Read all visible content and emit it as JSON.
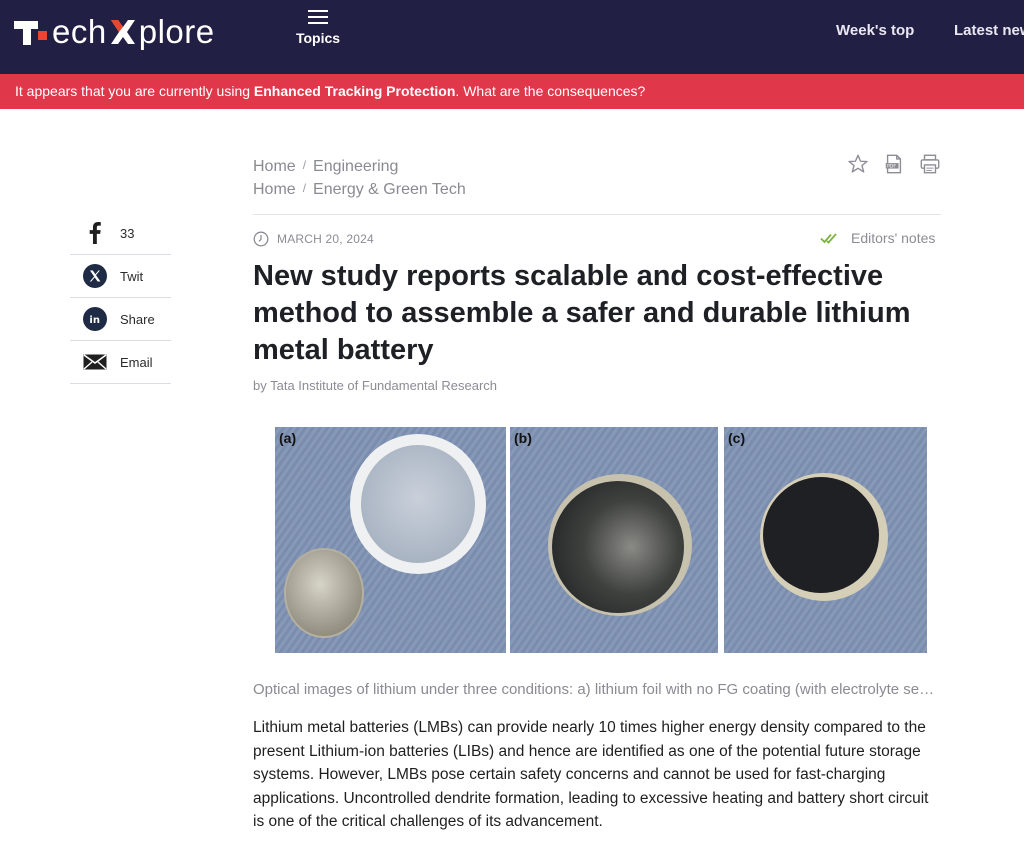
{
  "header": {
    "logo_left": "ech",
    "logo_right": "plore",
    "topics_label": "Topics",
    "nav": [
      "Week's top",
      "Latest news"
    ]
  },
  "alert": {
    "prefix": "It appears that you are currently using ",
    "bold": "Enhanced Tracking Protection",
    "suffix": ". What are the consequences?"
  },
  "breadcrumbs": [
    {
      "home": "Home",
      "section": "Engineering"
    },
    {
      "home": "Home",
      "section": "Energy & Green Tech"
    }
  ],
  "tools": [
    "star-icon",
    "pdf-icon",
    "print-icon"
  ],
  "share": [
    {
      "icon": "facebook-icon",
      "label": "33"
    },
    {
      "icon": "x-icon",
      "label": "Twit"
    },
    {
      "icon": "linkedin-icon",
      "label": "Share"
    },
    {
      "icon": "email-icon",
      "label": "Email"
    }
  ],
  "article": {
    "date": "MARCH 20, 2024",
    "editors_notes": "Editors' notes",
    "title": "New study reports scalable and cost-effective method to assemble a safer and durable lithium metal battery",
    "byline": "by Tata Institute of Fundamental Research",
    "figure_labels": [
      "(a)",
      "(b)",
      "(c)"
    ],
    "caption": "Optical images of lithium under three conditions: a) lithium foil with no FG coating (with electrolyte separator), b) lithium foil with FG coating, c) lithium foil after cycling",
    "body": "Lithium metal batteries (LMBs) can provide nearly 10 times higher energy density compared to the present Lithium-ion batteries (LIBs) and hence are identified as one of the potential future storage systems. However, LMBs pose certain safety concerns and cannot be used for fast-charging applications. Uncontrolled dendrite formation, leading to excessive heating and battery short circuit is one of the critical challenges of its advancement."
  },
  "colors": {
    "header_bg": "#221f44",
    "alert_bg": "#e0384a",
    "logo_accent": "#e8462f",
    "editors_check": "#7cb342"
  }
}
